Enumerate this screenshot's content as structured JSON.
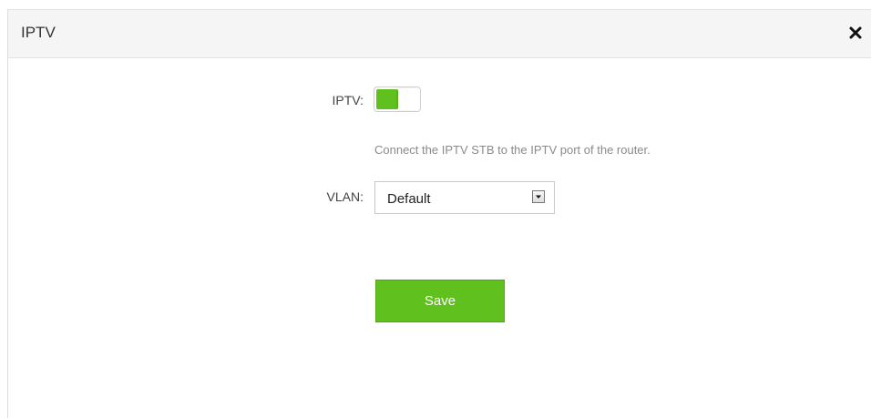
{
  "dialog": {
    "title": "IPTV",
    "close_icon": "close-icon"
  },
  "form": {
    "iptv": {
      "label": "IPTV:",
      "enabled": true,
      "accent_color": "#5fc01e"
    },
    "hint": "Connect the IPTV STB to the IPTV port of the router.",
    "vlan": {
      "label": "VLAN:",
      "value": "Default",
      "arrow_icon": "chevron-down-icon"
    },
    "save_label": "Save"
  }
}
